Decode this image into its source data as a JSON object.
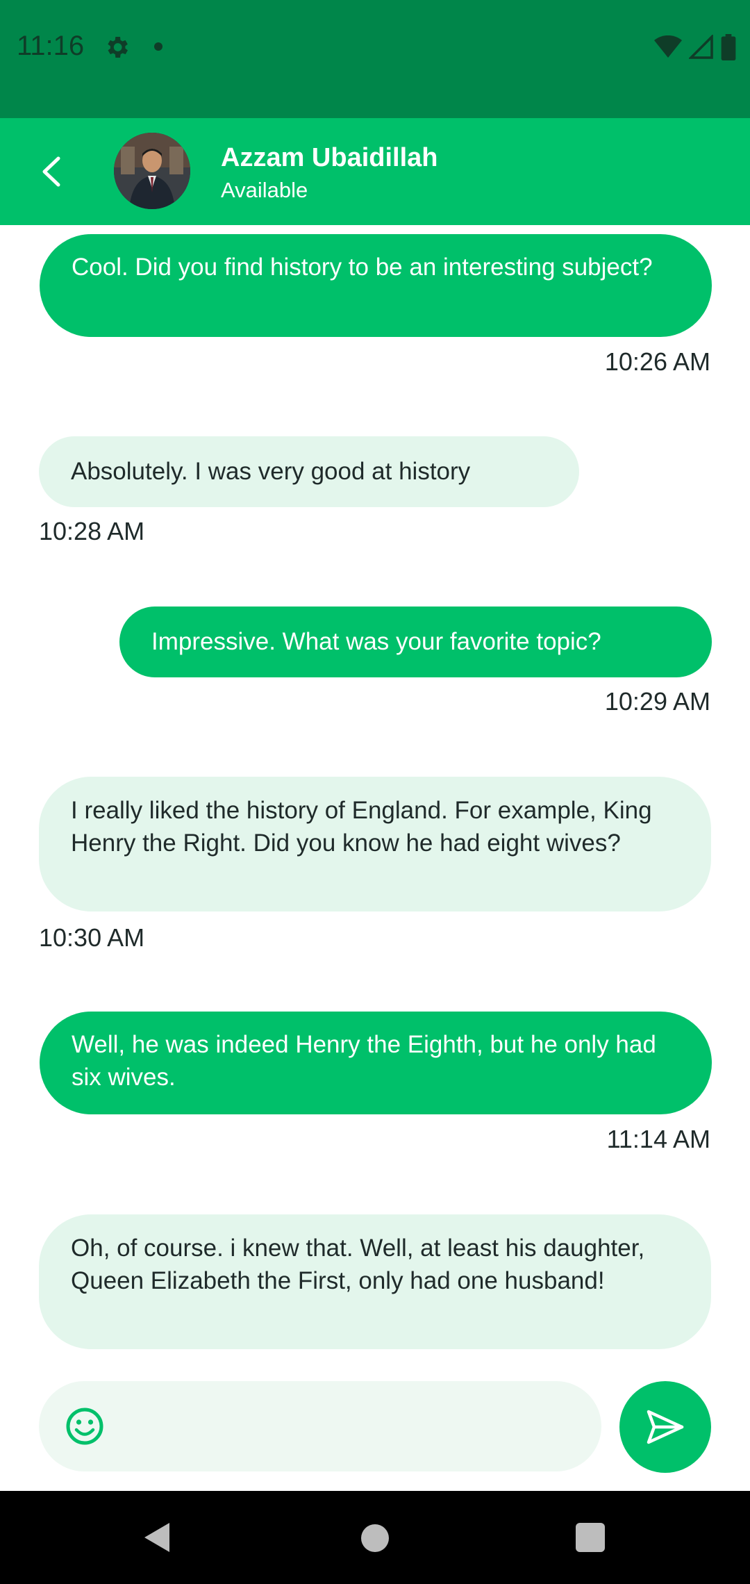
{
  "status_bar": {
    "time": "11:16",
    "icons": [
      "settings-icon",
      "notification-dot-icon",
      "wifi-icon",
      "signal-icon",
      "battery-icon"
    ]
  },
  "header": {
    "contact_name": "Azzam Ubaidillah",
    "contact_status": "Available",
    "back_icon": "chevron-left-icon"
  },
  "messages": [
    {
      "direction": "outgoing",
      "text": "Cool. Did you find history to be an interesting subject?",
      "time": "10:26 AM"
    },
    {
      "direction": "incoming",
      "text": "Absolutely. I was very good at history",
      "time": "10:28 AM"
    },
    {
      "direction": "outgoing",
      "text": "Impressive. What was your favorite topic?",
      "time": "10:29 AM"
    },
    {
      "direction": "incoming",
      "text": "I really liked the history of England. For example, King Henry the Right. Did you know he had eight wives?",
      "time": "10:30 AM"
    },
    {
      "direction": "outgoing",
      "text": "Well, he was indeed Henry the Eighth, but he only had six wives.",
      "time": "11:14 AM"
    },
    {
      "direction": "incoming",
      "text": "Oh, of course. i knew that. Well, at least his daughter, Queen Elizabeth the First, only had one husband!",
      "time": ""
    }
  ],
  "composer": {
    "value": "",
    "placeholder": "",
    "emoji_icon": "emoji-icon",
    "send_icon": "send-icon"
  },
  "colors": {
    "status_bar": "#00864a",
    "header": "#00c06a",
    "outgoing_bubble": "#00c06a",
    "incoming_bubble": "#e3f6ec"
  }
}
